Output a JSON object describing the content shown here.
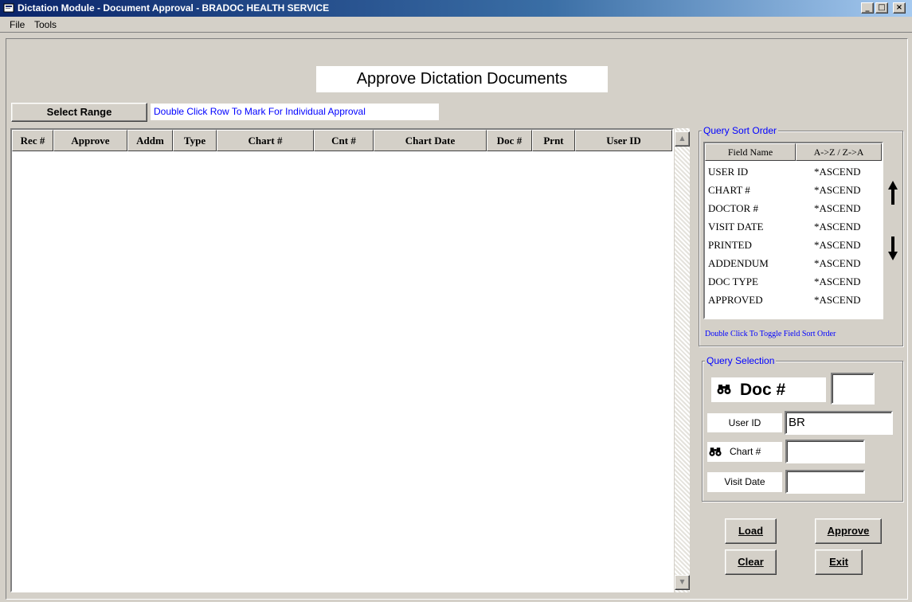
{
  "window": {
    "title": "Dictation Module - Document Approval - BRADOC HEALTH SERVICE",
    "controls": [
      "_",
      "□",
      "×"
    ]
  },
  "menu": [
    "File",
    "Tools"
  ],
  "heading": "Approve Dictation Documents",
  "select_range_label": "Select Range",
  "select_range_mnemonic": "S",
  "row_hint": "Double Click Row To Mark For Individual Approval",
  "grid": {
    "columns": [
      "Rec #",
      "Approve",
      "Addm",
      "Type",
      "Chart #",
      "Cnt #",
      "Chart Date",
      "Doc #",
      "Prnt",
      "User ID"
    ],
    "rows": []
  },
  "sort_order": {
    "legend": "Query Sort Order",
    "headers": [
      "Field Name",
      "A->Z / Z->A"
    ],
    "rows": [
      {
        "field": "USER ID",
        "order": "*ASCEND"
      },
      {
        "field": "CHART #",
        "order": "*ASCEND"
      },
      {
        "field": "DOCTOR #",
        "order": "*ASCEND"
      },
      {
        "field": "VISIT DATE",
        "order": "*ASCEND"
      },
      {
        "field": "PRINTED",
        "order": "*ASCEND"
      },
      {
        "field": "ADDENDUM",
        "order": "*ASCEND"
      },
      {
        "field": "DOC TYPE",
        "order": "*ASCEND"
      },
      {
        "field": "APPROVED",
        "order": "*ASCEND"
      }
    ],
    "hint": "Double Click To Toggle Field Sort Order"
  },
  "query_selection": {
    "legend": "Query Selection",
    "doc_label": "Doc #",
    "doc_value": "",
    "user_label": "User ID",
    "user_value": "BR",
    "chart_label": "Chart #",
    "chart_value": "",
    "visit_label": "Visit Date",
    "visit_value": ""
  },
  "buttons": {
    "load": "Load",
    "approve": "Approve",
    "clear": "Clear",
    "exit": "Exit"
  },
  "icons": {
    "binoculars": "binoculars-icon",
    "up": "arrow-up-icon",
    "down": "arrow-down-icon"
  }
}
